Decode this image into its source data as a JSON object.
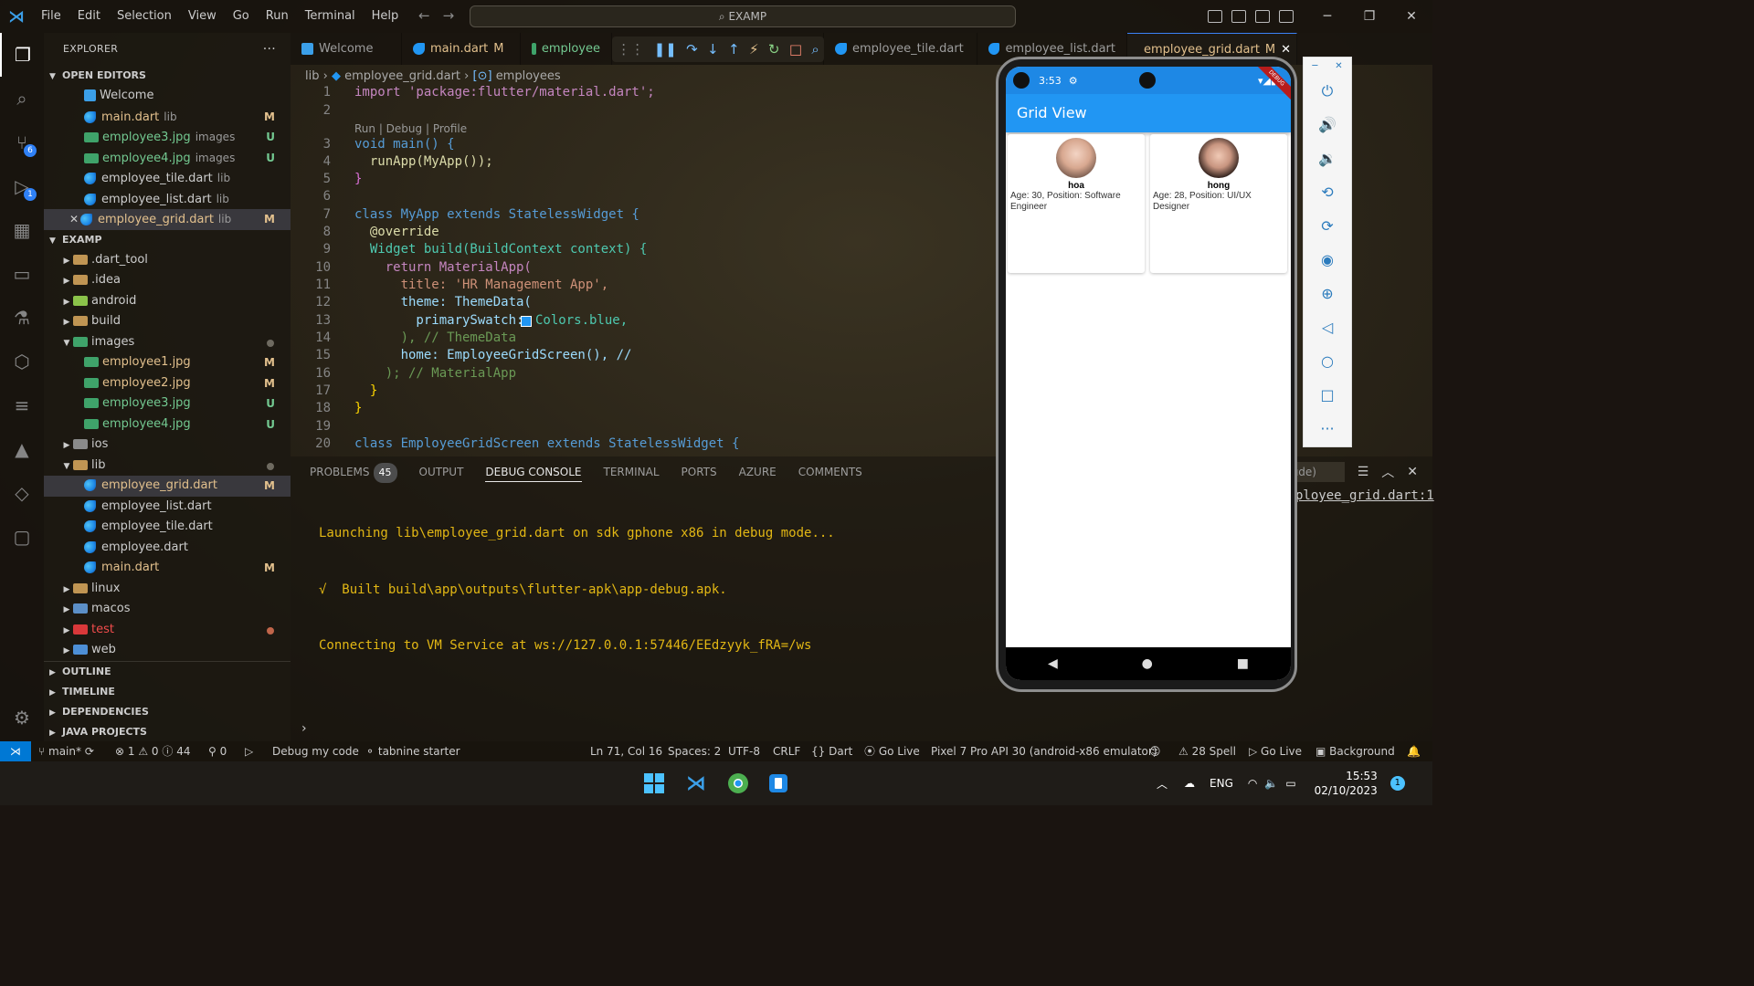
{
  "titlebar": {
    "menu": [
      "File",
      "Edit",
      "Selection",
      "View",
      "Go",
      "Run",
      "Terminal",
      "Help"
    ],
    "search": "EXAMP"
  },
  "activity": {
    "badges": {
      "scm": "6",
      "debug": "1"
    }
  },
  "explorer": {
    "title": "EXPLORER",
    "open_editors_label": "OPEN EDITORS",
    "open_editors": [
      {
        "name": "Welcome",
        "desc": "",
        "status": "",
        "kind": "vscode"
      },
      {
        "name": "main.dart",
        "desc": "lib",
        "status": "M",
        "kind": "dart"
      },
      {
        "name": "employee3.jpg",
        "desc": "images",
        "status": "U",
        "kind": "img"
      },
      {
        "name": "employee4.jpg",
        "desc": "images",
        "status": "U",
        "kind": "img"
      },
      {
        "name": "employee_tile.dart",
        "desc": "lib",
        "status": "",
        "kind": "dart"
      },
      {
        "name": "employee_list.dart",
        "desc": "lib",
        "status": "",
        "kind": "dart"
      },
      {
        "name": "employee_grid.dart",
        "desc": "lib",
        "status": "M",
        "kind": "dart"
      }
    ],
    "project_label": "EXAMP",
    "tree": [
      {
        "name": ".dart_tool",
        "status": ""
      },
      {
        "name": ".idea",
        "status": ""
      },
      {
        "name": "android",
        "status": ""
      },
      {
        "name": "build",
        "status": ""
      },
      {
        "name": "images",
        "status": "dot"
      },
      {
        "name": "employee1.jpg",
        "status": "M"
      },
      {
        "name": "employee2.jpg",
        "status": "M"
      },
      {
        "name": "employee3.jpg",
        "status": "U"
      },
      {
        "name": "employee4.jpg",
        "status": "U"
      },
      {
        "name": "ios",
        "status": ""
      },
      {
        "name": "lib",
        "status": "dot"
      },
      {
        "name": "employee_grid.dart",
        "status": "M"
      },
      {
        "name": "employee_list.dart",
        "status": ""
      },
      {
        "name": "employee_tile.dart",
        "status": ""
      },
      {
        "name": "employee.dart",
        "status": ""
      },
      {
        "name": "main.dart",
        "status": "M"
      },
      {
        "name": "linux",
        "status": ""
      },
      {
        "name": "macos",
        "status": ""
      },
      {
        "name": "test",
        "status": "dot"
      },
      {
        "name": "web",
        "status": ""
      }
    ],
    "sections": [
      "OUTLINE",
      "TIMELINE",
      "DEPENDENCIES",
      "JAVA PROJECTS"
    ]
  },
  "tabs": [
    {
      "label": "Welcome",
      "mod": ""
    },
    {
      "label": "main.dart",
      "mod": "M"
    },
    {
      "label": "employee",
      "mod": ""
    },
    {
      "label": "employee_tile.dart",
      "mod": ""
    },
    {
      "label": "employee_list.dart",
      "mod": ""
    },
    {
      "label": "employee_grid.dart",
      "mod": "M"
    }
  ],
  "breadcrumb": {
    "folder": "lib",
    "file": "employee_grid.dart",
    "symbol": "employees"
  },
  "editor": {
    "codelens": "Run | Debug | Profile",
    "line_numbers": [
      "1",
      "2",
      "3",
      "4",
      "5",
      "6",
      "7",
      "8",
      "9",
      "10",
      "11",
      "12",
      "13",
      "14",
      "15",
      "16",
      "17",
      "18",
      "19",
      "20"
    ],
    "lines": {
      "l1": "import 'package:flutter/material.dart';",
      "l3": "void main() {",
      "l4": "  runApp(MyApp());",
      "l5": "}",
      "l7": "class MyApp extends StatelessWidget {",
      "l8": "  @override",
      "l9": "  Widget build(BuildContext context) {",
      "l10": "    return MaterialApp(",
      "l11": "      title: 'HR Management App',",
      "l12": "      theme: ThemeData(",
      "l13": "        primarySwatch: ",
      "l13b": "Colors.blue,",
      "l14": "      ), // ThemeData",
      "l15": "      home: EmployeeGridScreen(), //",
      "l16": "    ); // MaterialApp",
      "l17": "  }",
      "l18": "}",
      "l20": "class EmployeeGridScreen extends StatelessWidget {"
    }
  },
  "panel": {
    "tabs": [
      "PROBLEMS",
      "OUTPUT",
      "DEBUG CONSOLE",
      "TERMINAL",
      "PORTS",
      "AZURE",
      "COMMENTS"
    ],
    "problems_count": "45",
    "console": [
      "Launching lib\\employee_grid.dart on sdk gphone x86 in debug mode...",
      "√  Built build\\app\\outputs\\flutter-apk\\app-debug.apk.",
      "Connecting to VM Service at ws://127.0.0.1:57446/EEdzyyk_fRA=/ws"
    ],
    "filter_text": "ude)",
    "right_link": "ployee_grid.dart:1"
  },
  "phone": {
    "time": "3:53",
    "app_title": "Grid View",
    "debug_label": "DEBUG",
    "employees": [
      {
        "name": "hoa",
        "info": "Age: 30, Position: Software Engineer"
      },
      {
        "name": "hong",
        "info": "Age: 28, Position: UI/UX Designer"
      }
    ]
  },
  "statusbar": {
    "branch": "main*",
    "errors": "1",
    "warnings": "0",
    "infos": "44",
    "ports": "0",
    "debug": "Debug my code",
    "tabnine": "tabnine starter",
    "cursor": "Ln 71, Col 16",
    "spaces": "Spaces: 2",
    "encoding": "UTF-8",
    "eol": "CRLF",
    "language": "Dart",
    "golive1": "Go Live",
    "device": "Pixel 7 Pro API 30 (android-x86 emulator)",
    "spell": "28 Spell",
    "golive2": "Go Live",
    "background": "Background"
  },
  "taskbar": {
    "lang": "ENG",
    "time": "15:53",
    "date": "02/10/2023",
    "notif": "1"
  }
}
